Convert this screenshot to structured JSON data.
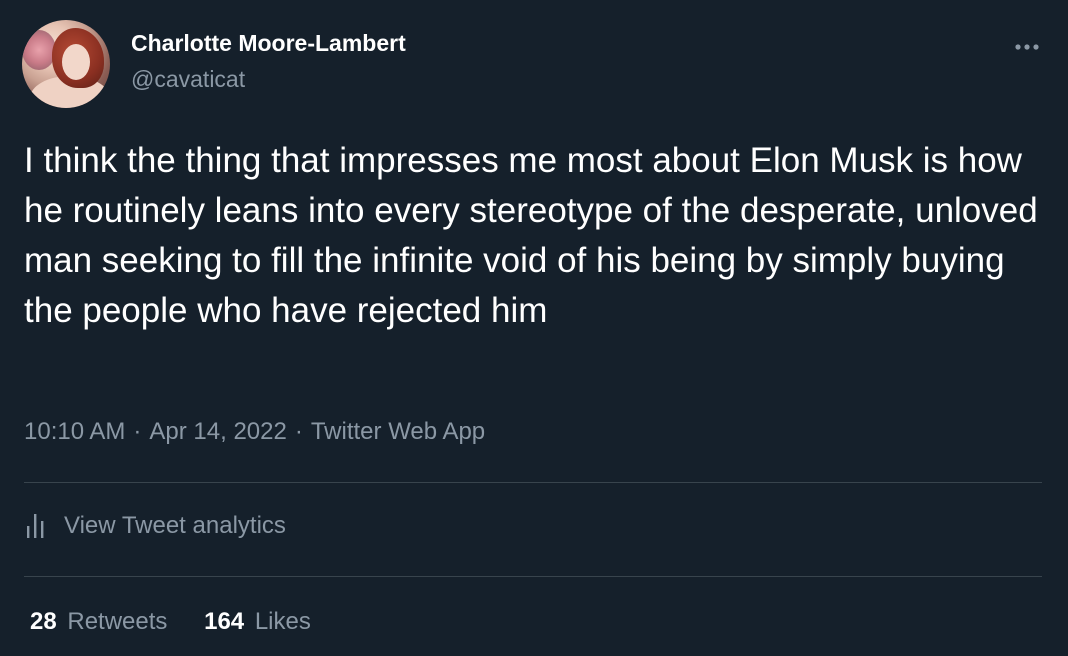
{
  "author": {
    "name": "Charlotte Moore-Lambert",
    "handle": "@cavaticat"
  },
  "tweet": {
    "text": "I think the thing that impresses me most about Elon Musk is how he routinely leans into every stereotype of the desperate, unloved man seeking to fill the infinite void of his being by simply buying the people who have rejected him",
    "time": "10:10 AM",
    "date": "Apr 14, 2022",
    "source": "Twitter Web App",
    "separator": "·"
  },
  "analytics": {
    "label": "View Tweet analytics",
    "icon": "bar-chart-icon"
  },
  "stats": {
    "retweets_count": "28",
    "retweets_label": "Retweets",
    "likes_count": "164",
    "likes_label": "Likes"
  },
  "icons": {
    "more": "more-horizontal-icon"
  },
  "colors": {
    "background": "#15202b",
    "text_primary": "#ffffff",
    "text_secondary": "#8b98a5",
    "divider": "#38444d"
  }
}
